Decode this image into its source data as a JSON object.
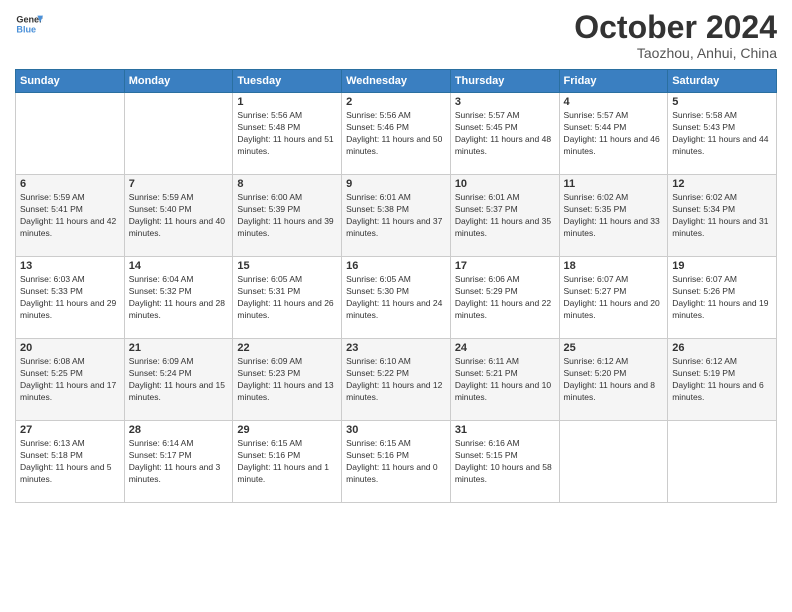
{
  "header": {
    "logo_line1": "General",
    "logo_line2": "Blue",
    "month_title": "October 2024",
    "location": "Taozhou, Anhui, China"
  },
  "days_of_week": [
    "Sunday",
    "Monday",
    "Tuesday",
    "Wednesday",
    "Thursday",
    "Friday",
    "Saturday"
  ],
  "weeks": [
    [
      {
        "day": "",
        "sunrise": "",
        "sunset": "",
        "daylight": ""
      },
      {
        "day": "",
        "sunrise": "",
        "sunset": "",
        "daylight": ""
      },
      {
        "day": "1",
        "sunrise": "Sunrise: 5:56 AM",
        "sunset": "Sunset: 5:48 PM",
        "daylight": "Daylight: 11 hours and 51 minutes."
      },
      {
        "day": "2",
        "sunrise": "Sunrise: 5:56 AM",
        "sunset": "Sunset: 5:46 PM",
        "daylight": "Daylight: 11 hours and 50 minutes."
      },
      {
        "day": "3",
        "sunrise": "Sunrise: 5:57 AM",
        "sunset": "Sunset: 5:45 PM",
        "daylight": "Daylight: 11 hours and 48 minutes."
      },
      {
        "day": "4",
        "sunrise": "Sunrise: 5:57 AM",
        "sunset": "Sunset: 5:44 PM",
        "daylight": "Daylight: 11 hours and 46 minutes."
      },
      {
        "day": "5",
        "sunrise": "Sunrise: 5:58 AM",
        "sunset": "Sunset: 5:43 PM",
        "daylight": "Daylight: 11 hours and 44 minutes."
      }
    ],
    [
      {
        "day": "6",
        "sunrise": "Sunrise: 5:59 AM",
        "sunset": "Sunset: 5:41 PM",
        "daylight": "Daylight: 11 hours and 42 minutes."
      },
      {
        "day": "7",
        "sunrise": "Sunrise: 5:59 AM",
        "sunset": "Sunset: 5:40 PM",
        "daylight": "Daylight: 11 hours and 40 minutes."
      },
      {
        "day": "8",
        "sunrise": "Sunrise: 6:00 AM",
        "sunset": "Sunset: 5:39 PM",
        "daylight": "Daylight: 11 hours and 39 minutes."
      },
      {
        "day": "9",
        "sunrise": "Sunrise: 6:01 AM",
        "sunset": "Sunset: 5:38 PM",
        "daylight": "Daylight: 11 hours and 37 minutes."
      },
      {
        "day": "10",
        "sunrise": "Sunrise: 6:01 AM",
        "sunset": "Sunset: 5:37 PM",
        "daylight": "Daylight: 11 hours and 35 minutes."
      },
      {
        "day": "11",
        "sunrise": "Sunrise: 6:02 AM",
        "sunset": "Sunset: 5:35 PM",
        "daylight": "Daylight: 11 hours and 33 minutes."
      },
      {
        "day": "12",
        "sunrise": "Sunrise: 6:02 AM",
        "sunset": "Sunset: 5:34 PM",
        "daylight": "Daylight: 11 hours and 31 minutes."
      }
    ],
    [
      {
        "day": "13",
        "sunrise": "Sunrise: 6:03 AM",
        "sunset": "Sunset: 5:33 PM",
        "daylight": "Daylight: 11 hours and 29 minutes."
      },
      {
        "day": "14",
        "sunrise": "Sunrise: 6:04 AM",
        "sunset": "Sunset: 5:32 PM",
        "daylight": "Daylight: 11 hours and 28 minutes."
      },
      {
        "day": "15",
        "sunrise": "Sunrise: 6:05 AM",
        "sunset": "Sunset: 5:31 PM",
        "daylight": "Daylight: 11 hours and 26 minutes."
      },
      {
        "day": "16",
        "sunrise": "Sunrise: 6:05 AM",
        "sunset": "Sunset: 5:30 PM",
        "daylight": "Daylight: 11 hours and 24 minutes."
      },
      {
        "day": "17",
        "sunrise": "Sunrise: 6:06 AM",
        "sunset": "Sunset: 5:29 PM",
        "daylight": "Daylight: 11 hours and 22 minutes."
      },
      {
        "day": "18",
        "sunrise": "Sunrise: 6:07 AM",
        "sunset": "Sunset: 5:27 PM",
        "daylight": "Daylight: 11 hours and 20 minutes."
      },
      {
        "day": "19",
        "sunrise": "Sunrise: 6:07 AM",
        "sunset": "Sunset: 5:26 PM",
        "daylight": "Daylight: 11 hours and 19 minutes."
      }
    ],
    [
      {
        "day": "20",
        "sunrise": "Sunrise: 6:08 AM",
        "sunset": "Sunset: 5:25 PM",
        "daylight": "Daylight: 11 hours and 17 minutes."
      },
      {
        "day": "21",
        "sunrise": "Sunrise: 6:09 AM",
        "sunset": "Sunset: 5:24 PM",
        "daylight": "Daylight: 11 hours and 15 minutes."
      },
      {
        "day": "22",
        "sunrise": "Sunrise: 6:09 AM",
        "sunset": "Sunset: 5:23 PM",
        "daylight": "Daylight: 11 hours and 13 minutes."
      },
      {
        "day": "23",
        "sunrise": "Sunrise: 6:10 AM",
        "sunset": "Sunset: 5:22 PM",
        "daylight": "Daylight: 11 hours and 12 minutes."
      },
      {
        "day": "24",
        "sunrise": "Sunrise: 6:11 AM",
        "sunset": "Sunset: 5:21 PM",
        "daylight": "Daylight: 11 hours and 10 minutes."
      },
      {
        "day": "25",
        "sunrise": "Sunrise: 6:12 AM",
        "sunset": "Sunset: 5:20 PM",
        "daylight": "Daylight: 11 hours and 8 minutes."
      },
      {
        "day": "26",
        "sunrise": "Sunrise: 6:12 AM",
        "sunset": "Sunset: 5:19 PM",
        "daylight": "Daylight: 11 hours and 6 minutes."
      }
    ],
    [
      {
        "day": "27",
        "sunrise": "Sunrise: 6:13 AM",
        "sunset": "Sunset: 5:18 PM",
        "daylight": "Daylight: 11 hours and 5 minutes."
      },
      {
        "day": "28",
        "sunrise": "Sunrise: 6:14 AM",
        "sunset": "Sunset: 5:17 PM",
        "daylight": "Daylight: 11 hours and 3 minutes."
      },
      {
        "day": "29",
        "sunrise": "Sunrise: 6:15 AM",
        "sunset": "Sunset: 5:16 PM",
        "daylight": "Daylight: 11 hours and 1 minute."
      },
      {
        "day": "30",
        "sunrise": "Sunrise: 6:15 AM",
        "sunset": "Sunset: 5:16 PM",
        "daylight": "Daylight: 11 hours and 0 minutes."
      },
      {
        "day": "31",
        "sunrise": "Sunrise: 6:16 AM",
        "sunset": "Sunset: 5:15 PM",
        "daylight": "Daylight: 10 hours and 58 minutes."
      },
      {
        "day": "",
        "sunrise": "",
        "sunset": "",
        "daylight": ""
      },
      {
        "day": "",
        "sunrise": "",
        "sunset": "",
        "daylight": ""
      }
    ]
  ]
}
